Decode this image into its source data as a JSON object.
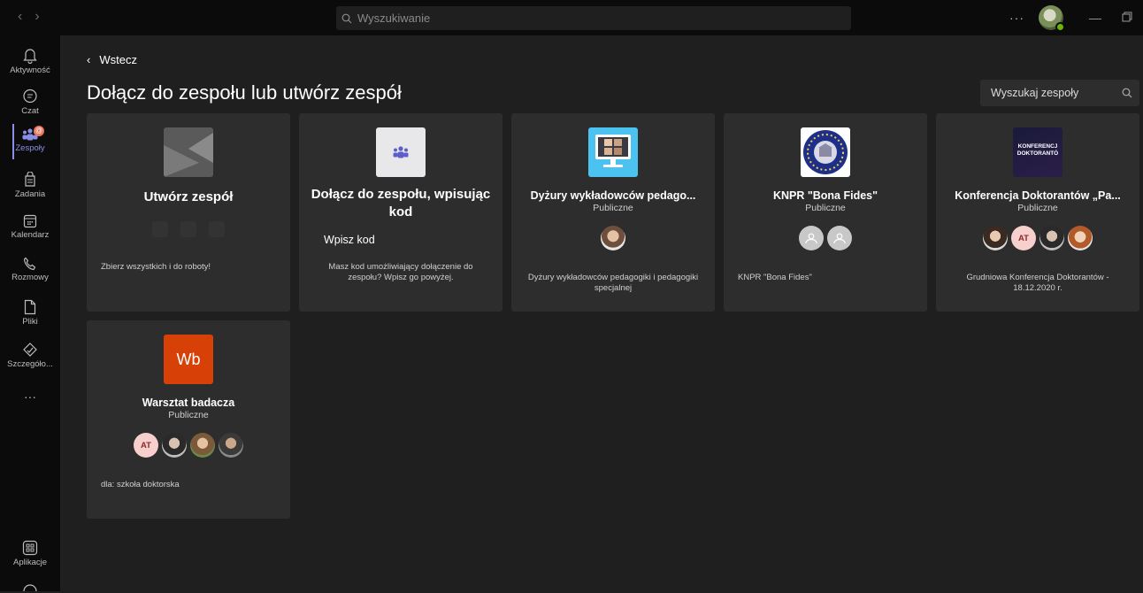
{
  "topbar": {
    "back_arrow": "‹",
    "forward_arrow": "›",
    "search_placeholder": "Wyszukiwanie",
    "more": "···"
  },
  "rail": {
    "items": [
      {
        "label": "Aktywność",
        "icon": "bell-icon"
      },
      {
        "label": "Czat",
        "icon": "chat-icon"
      },
      {
        "label": "Zespoły",
        "icon": "teams-icon",
        "badge": "@",
        "active": true
      },
      {
        "label": "Zadania",
        "icon": "assignments-icon"
      },
      {
        "label": "Kalendarz",
        "icon": "calendar-icon"
      },
      {
        "label": "Rozmowy",
        "icon": "phone-icon"
      },
      {
        "label": "Pliki",
        "icon": "file-icon"
      },
      {
        "label": "Szczegóło...",
        "icon": "insights-icon"
      }
    ],
    "more": "···",
    "apps_label": "Aplikacje"
  },
  "main": {
    "back_label": "Wstecz",
    "title": "Dołącz do zespołu lub utwórz zespół",
    "team_search_placeholder": "Wyszukaj zespoły"
  },
  "cards": {
    "create": {
      "name": "Utwórz zespół",
      "desc": "Zbierz wszystkich i do roboty!"
    },
    "join": {
      "name": "Dołącz do zespołu, wpisując kod",
      "input_placeholder": "Wpisz kod",
      "desc": "Masz kod umożliwiający dołączenie do zespołu? Wpisz go powyżej."
    },
    "dyzury": {
      "name": "Dyżury wykładowców pedago...",
      "visibility": "Publiczne",
      "desc": "Dyżury wykładowców pedagogiki i pedagogiki specjalnej"
    },
    "knpr": {
      "name": "KNPR \"Bona Fides\"",
      "visibility": "Publiczne",
      "desc": "KNPR \"Bona Fides\""
    },
    "konferencja": {
      "name": "Konferencja Doktorantów „Pa...",
      "visibility": "Publiczne",
      "desc": "Grudniowa Konferencja Doktorantów - 18.12.2020 r.",
      "thumb_text": "KONFERENCJ DOKTORANTÓ",
      "avatar_initials": "AT"
    },
    "warsztat": {
      "name": "Warsztat badacza",
      "visibility": "Publiczne",
      "desc": "dla: szkoła doktorska",
      "thumb_text": "Wb",
      "avatar_initials": "AT"
    }
  },
  "colors": {
    "accent": "#8a8fe8",
    "wb_tile": "#d74108",
    "badge": "#e9775c",
    "card_bg": "#2d2d2d"
  }
}
